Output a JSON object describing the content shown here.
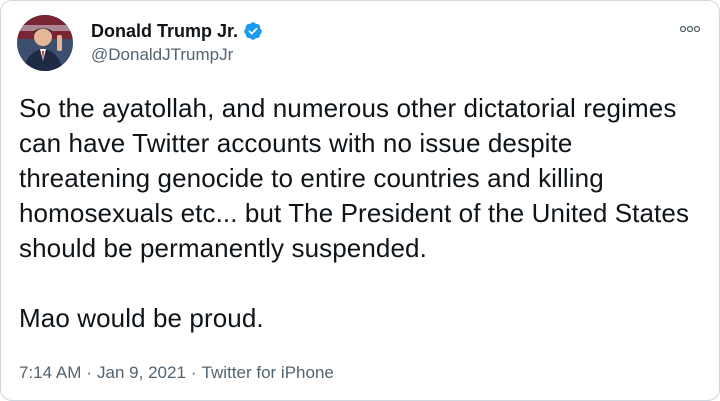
{
  "tweet": {
    "author": {
      "display_name": "Donald Trump Jr.",
      "handle": "@DonaldJTrumpJr",
      "verified": true,
      "avatar_icon": "profile-photo"
    },
    "body_paragraphs": [
      "So the ayatollah, and numerous other dictatorial regimes can have Twitter accounts with no issue despite threatening genocide to entire countries and killing homosexuals etc... but The President of the United States should be permanently suspended.",
      "Mao would be proud."
    ],
    "meta": {
      "time": "7:14 AM",
      "separator": "·",
      "date": "Jan 9, 2021",
      "source": "Twitter for iPhone"
    },
    "more_icon": "more-options-icon"
  },
  "colors": {
    "text": "#0f1419",
    "secondary": "#536471",
    "verified_blue": "#1d9bf0",
    "border": "#cfd9de"
  }
}
